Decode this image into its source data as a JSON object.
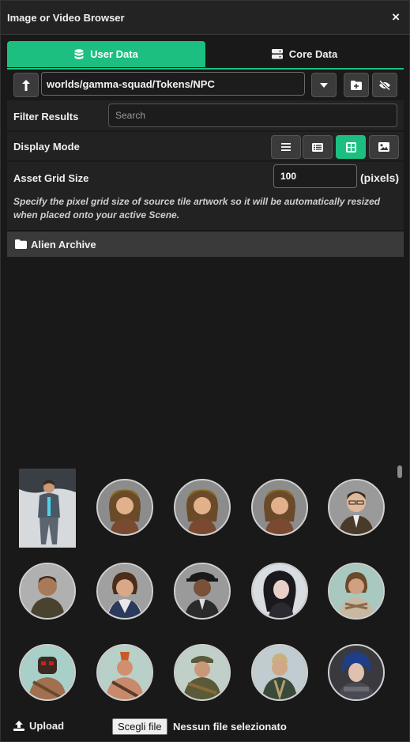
{
  "window": {
    "title": "Image or Video Browser",
    "close_glyph": "×"
  },
  "tabs": [
    {
      "label": "User Data",
      "icon": "database-icon",
      "active": true
    },
    {
      "label": "Core Data",
      "icon": "server-icon",
      "active": false
    }
  ],
  "path": {
    "value": "worlds/gamma-squad/Tokens/NPC"
  },
  "filter": {
    "label": "Filter Results",
    "placeholder": "Search"
  },
  "display": {
    "label": "Display Mode",
    "modes": [
      "list",
      "detail",
      "tiles",
      "images"
    ],
    "active": "tiles"
  },
  "grid": {
    "label": "Asset Grid Size",
    "value": "100",
    "unit": "(pixels)",
    "hint": "Specify the pixel grid size of source tile artwork so it will be automatically resized when placed onto your active Scene."
  },
  "folder": {
    "name": "Alien Archive"
  },
  "footer": {
    "upload_label": "Upload",
    "file_button": "Scegli file",
    "file_status": "Nessun file selezionato"
  },
  "colors": {
    "accent": "#1cbf7f",
    "background": "#191919"
  }
}
